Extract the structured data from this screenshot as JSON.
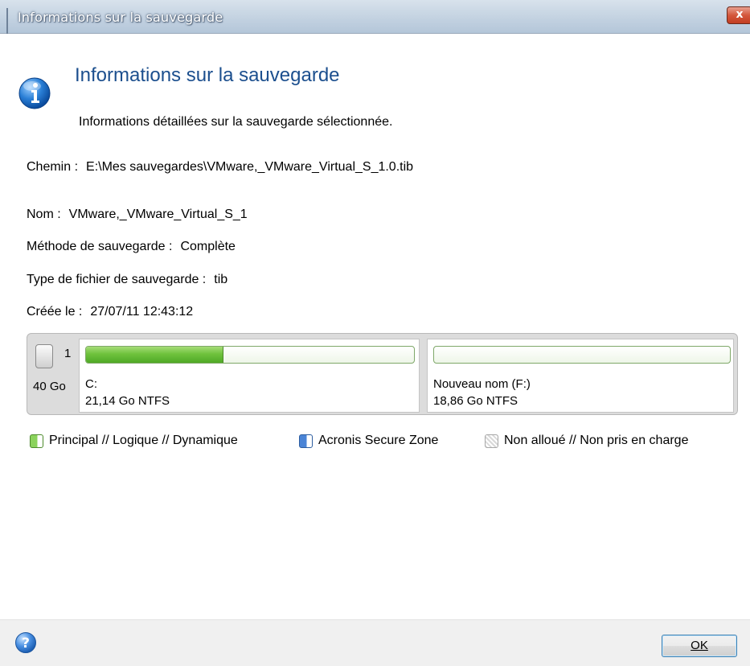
{
  "window": {
    "title": "Informations sur la sauvegarde",
    "close_label": "x"
  },
  "header": {
    "icon": "info-icon",
    "title": "Informations sur la sauvegarde",
    "subtitle": "Informations détaillées sur la sauvegarde sélectionnée."
  },
  "details": {
    "path": {
      "label": "Chemin :",
      "value": "E:\\Mes sauvegardes\\VMware,_VMware_Virtual_S_1.0.tib"
    },
    "name": {
      "label": "Nom :",
      "value": "VMware,_VMware_Virtual_S_1"
    },
    "method": {
      "label": "Méthode de sauvegarde :",
      "value": "Complète"
    },
    "file_type": {
      "label": "Type de fichier de sauvegarde :",
      "value": "tib"
    },
    "created": {
      "label": "Créée le :",
      "value": "27/07/11 12:43:12"
    }
  },
  "disk": {
    "number": "1",
    "size": "40 Go",
    "icon": "hard-disk-icon",
    "partitions": [
      {
        "name": "C:",
        "info": "21,14 Go  NTFS",
        "used_fraction": 0.42
      },
      {
        "name": "Nouveau nom (F:)",
        "info": "18,86 Go  NTFS",
        "used_fraction": 0.0
      }
    ]
  },
  "legend": {
    "primary": "Principal // Logique // Dynamique",
    "secure_zone": "Acronis Secure Zone",
    "unallocated": "Non alloué // Non pris en charge"
  },
  "colors": {
    "partition_fill": "#6fc23d",
    "heading": "#1c4f8e",
    "secure_zone": "#4a84d6"
  },
  "footer": {
    "help_icon": "help-icon",
    "ok_label": "OK"
  }
}
